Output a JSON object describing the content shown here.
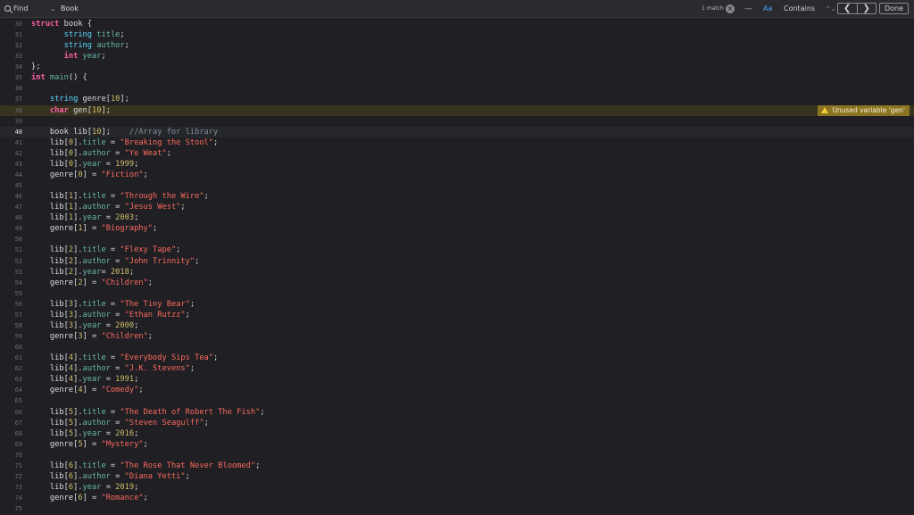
{
  "findbar": {
    "mode_label": "Find",
    "query": "Book",
    "match_count": "1 match",
    "dash_label": "—",
    "case_label": "Aa",
    "contains_label": "Contains",
    "prev_label": "❮",
    "next_label": "❯",
    "done_label": "Done"
  },
  "warning": {
    "text": "Unused variable 'gen'"
  },
  "lines": [
    {
      "n": "30",
      "t": [
        [
          "kw",
          "struct "
        ],
        [
          "",
          "book {"
        ]
      ]
    },
    {
      "n": "31",
      "t": [
        [
          "",
          "       "
        ],
        [
          "tp",
          "string "
        ],
        [
          "mb",
          "title"
        ],
        [
          "",
          ";"
        ]
      ]
    },
    {
      "n": "32",
      "t": [
        [
          "",
          "       "
        ],
        [
          "tp",
          "string "
        ],
        [
          "mb",
          "author"
        ],
        [
          "",
          ";"
        ]
      ]
    },
    {
      "n": "33",
      "t": [
        [
          "",
          "       "
        ],
        [
          "kw",
          "int "
        ],
        [
          "mb",
          "year"
        ],
        [
          "",
          ";"
        ]
      ]
    },
    {
      "n": "34",
      "t": [
        [
          "",
          "};"
        ]
      ]
    },
    {
      "n": "35",
      "t": [
        [
          "kw",
          "int "
        ],
        [
          "fn",
          "main"
        ],
        [
          "",
          "() {"
        ]
      ]
    },
    {
      "n": "36",
      "t": []
    },
    {
      "n": "37",
      "t": [
        [
          "",
          "    "
        ],
        [
          "tp",
          "string "
        ],
        [
          "",
          "genre["
        ],
        [
          "nm",
          "10"
        ],
        [
          "",
          "];"
        ]
      ]
    },
    {
      "n": "38",
      "t": [
        [
          "",
          "    "
        ],
        [
          "kw",
          "char "
        ],
        [
          "",
          "gen["
        ],
        [
          "nm",
          "10"
        ],
        [
          "",
          "];"
        ]
      ]
    },
    {
      "n": "39",
      "t": []
    },
    {
      "n": "40",
      "t": [
        [
          "",
          "    book lib["
        ],
        [
          "nm",
          "10"
        ],
        [
          "",
          "];    "
        ],
        [
          "cm",
          "//Array for library"
        ]
      ]
    },
    {
      "n": "41",
      "t": [
        [
          "",
          "    lib["
        ],
        [
          "nm",
          "0"
        ],
        [
          "",
          "]."
        ],
        [
          "mb",
          "title"
        ],
        [
          "",
          " = "
        ],
        [
          "st",
          "\"Breaking the Stool\""
        ],
        [
          "",
          ";"
        ]
      ]
    },
    {
      "n": "42",
      "t": [
        [
          "",
          "    lib["
        ],
        [
          "nm",
          "0"
        ],
        [
          "",
          "]."
        ],
        [
          "mb",
          "author"
        ],
        [
          "",
          " = "
        ],
        [
          "st",
          "\"Ye Weat\""
        ],
        [
          "",
          ";"
        ]
      ]
    },
    {
      "n": "43",
      "t": [
        [
          "",
          "    lib["
        ],
        [
          "nm",
          "0"
        ],
        [
          "",
          "]."
        ],
        [
          "mb",
          "year"
        ],
        [
          "",
          " = "
        ],
        [
          "nm",
          "1999"
        ],
        [
          "",
          ";"
        ]
      ]
    },
    {
      "n": "44",
      "t": [
        [
          "",
          "    genre["
        ],
        [
          "nm",
          "0"
        ],
        [
          "",
          "] = "
        ],
        [
          "st",
          "\"Fiction\""
        ],
        [
          "",
          ";"
        ]
      ]
    },
    {
      "n": "45",
      "t": []
    },
    {
      "n": "46",
      "t": [
        [
          "",
          "    lib["
        ],
        [
          "nm",
          "1"
        ],
        [
          "",
          "]."
        ],
        [
          "mb",
          "title"
        ],
        [
          "",
          " = "
        ],
        [
          "st",
          "\"Through the Wire\""
        ],
        [
          "",
          ";"
        ]
      ]
    },
    {
      "n": "47",
      "t": [
        [
          "",
          "    lib["
        ],
        [
          "nm",
          "1"
        ],
        [
          "",
          "]."
        ],
        [
          "mb",
          "author"
        ],
        [
          "",
          " = "
        ],
        [
          "st",
          "\"Jesus West\""
        ],
        [
          "",
          ";"
        ]
      ]
    },
    {
      "n": "48",
      "t": [
        [
          "",
          "    lib["
        ],
        [
          "nm",
          "1"
        ],
        [
          "",
          "]."
        ],
        [
          "mb",
          "year"
        ],
        [
          "",
          " = "
        ],
        [
          "nm",
          "2003"
        ],
        [
          "",
          ";"
        ]
      ]
    },
    {
      "n": "49",
      "t": [
        [
          "",
          "    genre["
        ],
        [
          "nm",
          "1"
        ],
        [
          "",
          "] = "
        ],
        [
          "st",
          "\"Biography\""
        ],
        [
          "",
          ";"
        ]
      ]
    },
    {
      "n": "50",
      "t": []
    },
    {
      "n": "51",
      "t": [
        [
          "",
          "    lib["
        ],
        [
          "nm",
          "2"
        ],
        [
          "",
          "]."
        ],
        [
          "mb",
          "title"
        ],
        [
          "",
          " = "
        ],
        [
          "st",
          "\"Flexy Tape\""
        ],
        [
          "",
          ";"
        ]
      ]
    },
    {
      "n": "52",
      "t": [
        [
          "",
          "    lib["
        ],
        [
          "nm",
          "2"
        ],
        [
          "",
          "]."
        ],
        [
          "mb",
          "author"
        ],
        [
          "",
          " = "
        ],
        [
          "st",
          "\"John Trinnity\""
        ],
        [
          "",
          ";"
        ]
      ]
    },
    {
      "n": "53",
      "t": [
        [
          "",
          "    lib["
        ],
        [
          "nm",
          "2"
        ],
        [
          "",
          "]."
        ],
        [
          "mb",
          "year"
        ],
        [
          "",
          "= "
        ],
        [
          "nm",
          "2018"
        ],
        [
          "",
          ";"
        ]
      ]
    },
    {
      "n": "54",
      "t": [
        [
          "",
          "    genre["
        ],
        [
          "nm",
          "2"
        ],
        [
          "",
          "] = "
        ],
        [
          "st",
          "\"Children\""
        ],
        [
          "",
          ";"
        ]
      ]
    },
    {
      "n": "55",
      "t": []
    },
    {
      "n": "56",
      "t": [
        [
          "",
          "    lib["
        ],
        [
          "nm",
          "3"
        ],
        [
          "",
          "]."
        ],
        [
          "mb",
          "title"
        ],
        [
          "",
          " = "
        ],
        [
          "st",
          "\"The Tiny Bear\""
        ],
        [
          "",
          ";"
        ]
      ]
    },
    {
      "n": "57",
      "t": [
        [
          "",
          "    lib["
        ],
        [
          "nm",
          "3"
        ],
        [
          "",
          "]."
        ],
        [
          "mb",
          "author"
        ],
        [
          "",
          " = "
        ],
        [
          "st",
          "\"Ethan Rutzz\""
        ],
        [
          "",
          ";"
        ]
      ]
    },
    {
      "n": "58",
      "t": [
        [
          "",
          "    lib["
        ],
        [
          "nm",
          "3"
        ],
        [
          "",
          "]."
        ],
        [
          "mb",
          "year"
        ],
        [
          "",
          " = "
        ],
        [
          "nm",
          "2000"
        ],
        [
          "",
          ";"
        ]
      ]
    },
    {
      "n": "59",
      "t": [
        [
          "",
          "    genre["
        ],
        [
          "nm",
          "3"
        ],
        [
          "",
          "] = "
        ],
        [
          "st",
          "\"Children\""
        ],
        [
          "",
          ";"
        ]
      ]
    },
    {
      "n": "60",
      "t": []
    },
    {
      "n": "61",
      "t": [
        [
          "",
          "    lib["
        ],
        [
          "nm",
          "4"
        ],
        [
          "",
          "]."
        ],
        [
          "mb",
          "title"
        ],
        [
          "",
          " = "
        ],
        [
          "st",
          "\"Everybody Sips Tea\""
        ],
        [
          "",
          ";"
        ]
      ]
    },
    {
      "n": "62",
      "t": [
        [
          "",
          "    lib["
        ],
        [
          "nm",
          "4"
        ],
        [
          "",
          "]."
        ],
        [
          "mb",
          "author"
        ],
        [
          "",
          " = "
        ],
        [
          "st",
          "\"J.K. Stevens\""
        ],
        [
          "",
          ";"
        ]
      ]
    },
    {
      "n": "63",
      "t": [
        [
          "",
          "    lib["
        ],
        [
          "nm",
          "4"
        ],
        [
          "",
          "]."
        ],
        [
          "mb",
          "year"
        ],
        [
          "",
          " = "
        ],
        [
          "nm",
          "1991"
        ],
        [
          "",
          ";"
        ]
      ]
    },
    {
      "n": "64",
      "t": [
        [
          "",
          "    genre["
        ],
        [
          "nm",
          "4"
        ],
        [
          "",
          "] = "
        ],
        [
          "st",
          "\"Comedy\""
        ],
        [
          "",
          ";"
        ]
      ]
    },
    {
      "n": "65",
      "t": []
    },
    {
      "n": "66",
      "t": [
        [
          "",
          "    lib["
        ],
        [
          "nm",
          "5"
        ],
        [
          "",
          "]."
        ],
        [
          "mb",
          "title"
        ],
        [
          "",
          " = "
        ],
        [
          "st",
          "\"The Death of Robert The Fish\""
        ],
        [
          "",
          ";"
        ]
      ]
    },
    {
      "n": "67",
      "t": [
        [
          "",
          "    lib["
        ],
        [
          "nm",
          "5"
        ],
        [
          "",
          "]."
        ],
        [
          "mb",
          "author"
        ],
        [
          "",
          " = "
        ],
        [
          "st",
          "\"Steven Seagulff\""
        ],
        [
          "",
          ";"
        ]
      ]
    },
    {
      "n": "68",
      "t": [
        [
          "",
          "    lib["
        ],
        [
          "nm",
          "5"
        ],
        [
          "",
          "]."
        ],
        [
          "mb",
          "year"
        ],
        [
          "",
          " = "
        ],
        [
          "nm",
          "2016"
        ],
        [
          "",
          ";"
        ]
      ]
    },
    {
      "n": "69",
      "t": [
        [
          "",
          "    genre["
        ],
        [
          "nm",
          "5"
        ],
        [
          "",
          "] = "
        ],
        [
          "st",
          "\"Mystery\""
        ],
        [
          "",
          ";"
        ]
      ]
    },
    {
      "n": "70",
      "t": []
    },
    {
      "n": "71",
      "t": [
        [
          "",
          "    lib["
        ],
        [
          "nm",
          "6"
        ],
        [
          "",
          "]."
        ],
        [
          "mb",
          "title"
        ],
        [
          "",
          " = "
        ],
        [
          "st",
          "\"The Rose That Never Bloomed\""
        ],
        [
          "",
          ";"
        ]
      ]
    },
    {
      "n": "72",
      "t": [
        [
          "",
          "    lib["
        ],
        [
          "nm",
          "6"
        ],
        [
          "",
          "]."
        ],
        [
          "mb",
          "author"
        ],
        [
          "",
          " = "
        ],
        [
          "st",
          "\"Diana Yetti\""
        ],
        [
          "",
          ";"
        ]
      ]
    },
    {
      "n": "73",
      "t": [
        [
          "",
          "    lib["
        ],
        [
          "nm",
          "6"
        ],
        [
          "",
          "]."
        ],
        [
          "mb",
          "year"
        ],
        [
          "",
          " = "
        ],
        [
          "nm",
          "2019"
        ],
        [
          "",
          ";"
        ]
      ]
    },
    {
      "n": "74",
      "t": [
        [
          "",
          "    genre["
        ],
        [
          "nm",
          "6"
        ],
        [
          "",
          "] = "
        ],
        [
          "st",
          "\"Romance\""
        ],
        [
          "",
          ";"
        ]
      ]
    },
    {
      "n": "75",
      "t": []
    }
  ]
}
